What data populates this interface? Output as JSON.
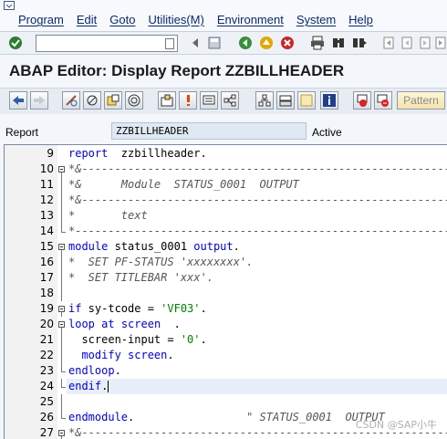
{
  "menu": {
    "items": [
      "Program",
      "Edit",
      "Goto",
      "Utilities(M)",
      "Environment",
      "System",
      "Help"
    ]
  },
  "toolbar": {
    "command_value": "",
    "icons": [
      "enter-check-icon",
      "command-dropdown-icon",
      "back-arrow-icon",
      "save-icon",
      "back-green-icon",
      "exit-yellow-icon",
      "cancel-red-icon",
      "print-icon",
      "find-icon",
      "find-next-icon",
      "first-page-icon",
      "prev-page-icon",
      "next-page-icon",
      "last-page-icon",
      "create-session-icon",
      "shortcut-icon"
    ]
  },
  "title": "ABAP Editor: Display Report ZZBILLHEADER",
  "app_toolbar": {
    "pattern_label": "Pattern",
    "icons": [
      "back-icon",
      "forward-icon",
      "display-change-icon",
      "other-object-icon",
      "activate-icon",
      "check-icon",
      "where-used-icon",
      "test-icon",
      "navigate-icon",
      "object-list-icon",
      "pretty-printer-icon",
      "insert-icon",
      "info-icon",
      "breakpoint-icon",
      "session-breakpoint-icon"
    ]
  },
  "report": {
    "label": "Report",
    "value": "ZZBILLHEADER",
    "status": "Active"
  },
  "editor": {
    "lines": [
      {
        "num": "9",
        "fold": "",
        "segments": [
          {
            "t": "report",
            "c": "kw"
          },
          {
            "t": "  zzbillheader.",
            "c": "sym"
          }
        ]
      },
      {
        "num": "10",
        "fold": "box",
        "segments": [
          {
            "t": "*&---------------------------------------------------------------------*",
            "c": "cm"
          }
        ]
      },
      {
        "num": "11",
        "fold": "bar",
        "segments": [
          {
            "t": "*&      Module  STATUS_0001  OUTPUT",
            "c": "cm"
          }
        ]
      },
      {
        "num": "12",
        "fold": "bar",
        "segments": [
          {
            "t": "*&---------------------------------------------------------------------*",
            "c": "cm"
          }
        ]
      },
      {
        "num": "13",
        "fold": "bar",
        "segments": [
          {
            "t": "*       text",
            "c": "cm"
          }
        ]
      },
      {
        "num": "14",
        "fold": "end",
        "segments": [
          {
            "t": "*----------------------------------------------------------------------*",
            "c": "cm"
          }
        ]
      },
      {
        "num": "15",
        "fold": "box",
        "segments": [
          {
            "t": "module",
            "c": "kw"
          },
          {
            "t": " status_0001 ",
            "c": "sym"
          },
          {
            "t": "output",
            "c": "kw"
          },
          {
            "t": ".",
            "c": "sym"
          }
        ]
      },
      {
        "num": "16",
        "fold": "bar",
        "segments": [
          {
            "t": "*  SET PF-STATUS 'xxxxxxxx'.",
            "c": "cm"
          }
        ]
      },
      {
        "num": "17",
        "fold": "bar",
        "segments": [
          {
            "t": "*  SET TITLEBAR 'xxx'.",
            "c": "cm"
          }
        ]
      },
      {
        "num": "18",
        "fold": "bar",
        "segments": [
          {
            "t": "",
            "c": "sym"
          }
        ]
      },
      {
        "num": "19",
        "fold": "box",
        "segments": [
          {
            "t": "if",
            "c": "kw"
          },
          {
            "t": " sy-tcode = ",
            "c": "sym"
          },
          {
            "t": "'VF03'",
            "c": "str"
          },
          {
            "t": ".",
            "c": "sym"
          }
        ]
      },
      {
        "num": "20",
        "fold": "box",
        "segments": [
          {
            "t": "loop",
            "c": "kw"
          },
          {
            "t": " ",
            "c": "sym"
          },
          {
            "t": "at",
            "c": "kw"
          },
          {
            "t": " ",
            "c": "sym"
          },
          {
            "t": "screen",
            "c": "kw"
          },
          {
            "t": "  .",
            "c": "sym"
          }
        ]
      },
      {
        "num": "21",
        "fold": "bar",
        "segments": [
          {
            "t": "  screen-input = ",
            "c": "sym"
          },
          {
            "t": "'0'",
            "c": "str"
          },
          {
            "t": ".",
            "c": "sym"
          }
        ]
      },
      {
        "num": "22",
        "fold": "bar",
        "segments": [
          {
            "t": "  modify",
            "c": "kw"
          },
          {
            "t": " ",
            "c": "sym"
          },
          {
            "t": "screen",
            "c": "kw"
          },
          {
            "t": ".",
            "c": "sym"
          }
        ]
      },
      {
        "num": "23",
        "fold": "end",
        "segments": [
          {
            "t": "endloop",
            "c": "kw"
          },
          {
            "t": ".",
            "c": "sym"
          }
        ]
      },
      {
        "num": "24",
        "fold": "end",
        "segments": [
          {
            "t": "endif",
            "c": "kw"
          },
          {
            "t": ".",
            "c": "sym"
          }
        ],
        "current": true
      },
      {
        "num": "25",
        "fold": "bar",
        "segments": [
          {
            "t": "",
            "c": "sym"
          }
        ]
      },
      {
        "num": "26",
        "fold": "end",
        "segments": [
          {
            "t": "endmodule",
            "c": "kw"
          },
          {
            "t": ".                 ",
            "c": "sym"
          },
          {
            "t": "\" STATUS_0001  OUTPUT",
            "c": "cm"
          }
        ]
      },
      {
        "num": "27",
        "fold": "box",
        "segments": [
          {
            "t": "*&---------------------------------------------------------------------*",
            "c": "cm"
          }
        ]
      }
    ]
  },
  "watermark": "CSDN @SAP小牛"
}
